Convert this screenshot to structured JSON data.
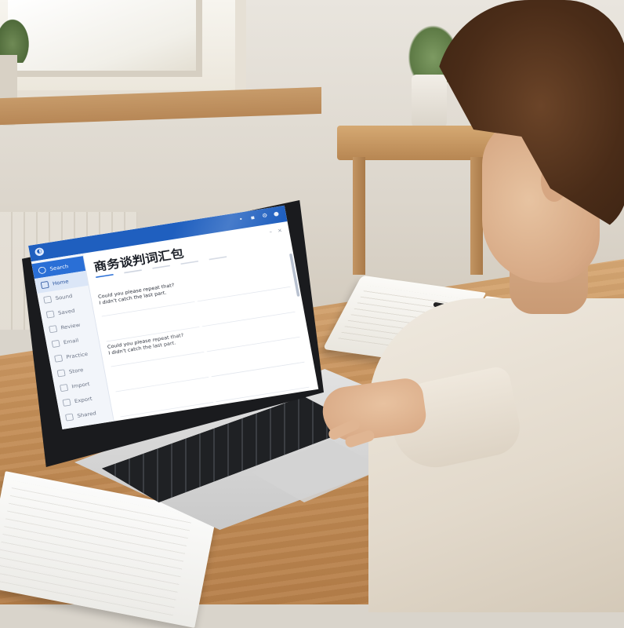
{
  "screen": {
    "app_title": "",
    "heading": "商务谈判词汇包",
    "top_icons": [
      "bell-icon",
      "grid-icon",
      "settings-icon",
      "user-icon"
    ],
    "sidebar": {
      "items": [
        {
          "label": "Search",
          "state": "active"
        },
        {
          "label": "Home",
          "state": "selected"
        },
        {
          "label": "Sound",
          "state": ""
        },
        {
          "label": "Saved",
          "state": ""
        },
        {
          "label": "Review",
          "state": ""
        },
        {
          "label": "Email",
          "state": ""
        },
        {
          "label": "Practice",
          "state": ""
        },
        {
          "label": "Store",
          "state": ""
        },
        {
          "label": "Import",
          "state": ""
        },
        {
          "label": "Export",
          "state": ""
        },
        {
          "label": "Shared",
          "state": ""
        }
      ]
    },
    "columns": {
      "left": {
        "heading": "",
        "cards": [
          {
            "en": "Could you please repeat that?\nI didn't catch the last part.",
            "zh": ""
          },
          {
            "en": "",
            "zh": ""
          },
          {
            "en": "Could you please repeat that?\nI didn't catch the last part.",
            "zh": ""
          },
          {
            "en": "",
            "zh": ""
          },
          {
            "en": "",
            "zh": ""
          }
        ]
      },
      "right": {
        "heading": "",
        "cards": [
          {
            "en": "",
            "zh": ""
          },
          {
            "en": "",
            "zh": ""
          },
          {
            "en": "",
            "zh": ""
          },
          {
            "en": "",
            "zh": ""
          },
          {
            "en": "",
            "zh": ""
          }
        ]
      }
    }
  },
  "colors": {
    "accent": "#1f5fbf",
    "active_nav": "#2a6fd6",
    "desk": "#c48e57",
    "shirt": "#e2d9cb",
    "hair": "#4a2c18"
  }
}
